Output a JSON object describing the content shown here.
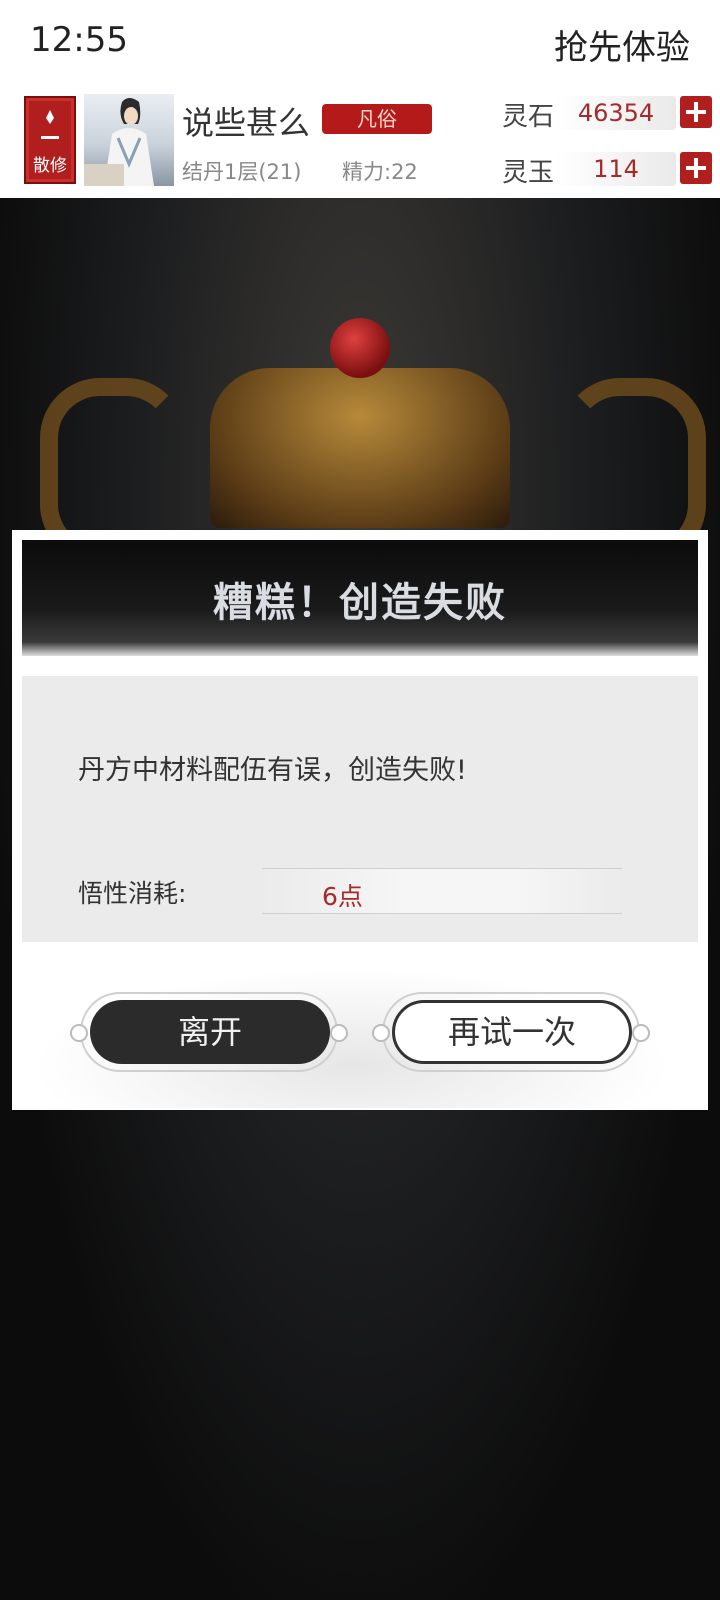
{
  "status_bar": {
    "time": "12:55",
    "right_text": "抢先体验"
  },
  "header": {
    "sect_label": "散修",
    "player_name": "说些甚么",
    "rank": "凡俗",
    "realm": "结丹1层(21)",
    "energy": "精力:22",
    "resources": [
      {
        "label": "灵石",
        "value": "46354"
      },
      {
        "label": "灵玉",
        "value": "114"
      }
    ]
  },
  "dialog": {
    "title": "糟糕！创造失败",
    "message": "丹方中材料配伍有误，创造失败!",
    "cost_label": "悟性消耗:",
    "cost_value": "6点",
    "buttons": {
      "leave": "离开",
      "retry": "再试一次"
    }
  },
  "colors": {
    "accent_red": "#b01e1e",
    "value_red": "#a52a2a",
    "dark_button": "#2b2b2b"
  }
}
